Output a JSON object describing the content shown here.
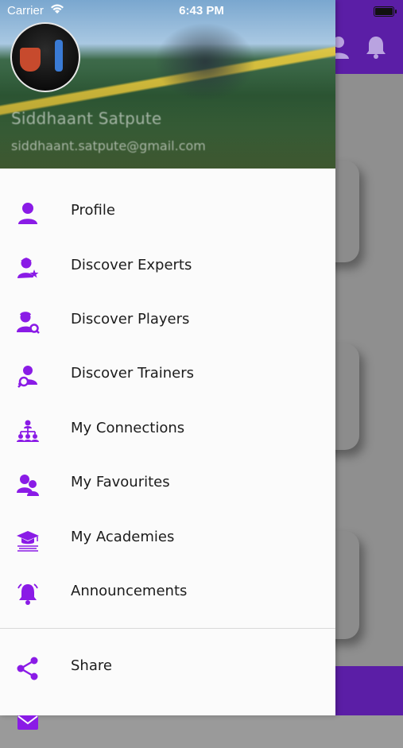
{
  "status_bar": {
    "carrier": "Carrier",
    "time": "6:43 PM",
    "icons": [
      "wifi-icon",
      "battery-icon"
    ]
  },
  "drawer_header": {
    "user_name": "Siddhaant Satpute",
    "user_email": "siddhaant.satpute@gmail.com"
  },
  "menu": {
    "items": [
      {
        "label": "Profile",
        "icon": "person-icon"
      },
      {
        "label": "Discover Experts",
        "icon": "expert-star-icon"
      },
      {
        "label": "Discover Players",
        "icon": "player-search-icon"
      },
      {
        "label": "Discover Trainers",
        "icon": "trainer-search-icon"
      },
      {
        "label": "My Connections",
        "icon": "connections-icon"
      },
      {
        "label": "My Favourites",
        "icon": "favourites-icon"
      },
      {
        "label": "My Academies",
        "icon": "academy-icon"
      },
      {
        "label": "Announcements",
        "icon": "bell-icon"
      }
    ],
    "secondary_items": [
      {
        "label": "Share",
        "icon": "share-icon"
      },
      {
        "label": "",
        "icon": "mail-icon"
      }
    ]
  },
  "colors": {
    "accent": "#8a1be6",
    "header_bar": "#5b1ea6"
  }
}
